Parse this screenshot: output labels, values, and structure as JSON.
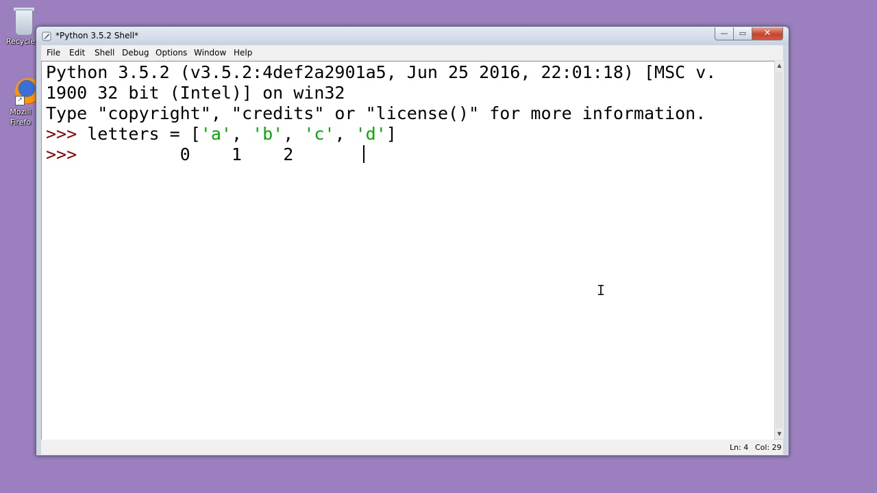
{
  "desktop": {
    "icons": [
      {
        "label": "Recycle",
        "icon": "recycle-bin-icon"
      },
      {
        "label": "Mozill\nFirefo",
        "icon": "firefox-icon"
      }
    ]
  },
  "window": {
    "title": "*Python 3.5.2 Shell*",
    "controls": {
      "minimize": "—",
      "maximize": "▭",
      "close": "✕"
    }
  },
  "menu": {
    "items": [
      "File",
      "Edit",
      "Shell",
      "Debug",
      "Options",
      "Window",
      "Help"
    ]
  },
  "shell": {
    "line1": "Python 3.5.2 (v3.5.2:4def2a2901a5, Jun 25 2016, 22:01:18) [MSC v.",
    "line2": "1900 32 bit (Intel)] on win32",
    "line3": "Type \"copyright\", \"credits\" or \"license()\" for more information.",
    "line4": {
      "prompt": ">>> ",
      "code_before": "letters = [",
      "s1": "'a'",
      "sep1": ", ",
      "s2": "'b'",
      "sep2": ", ",
      "s3": "'c'",
      "sep3": ", ",
      "s4": "'d'",
      "code_after": "]"
    },
    "line5": {
      "prompt": ">>> ",
      "content": "         0    1    2  "
    }
  },
  "statusbar": {
    "ln": "Ln: 4",
    "col": "Col: 29"
  },
  "colors": {
    "prompt": "#8b0000",
    "string": "#00aa00",
    "desktop": "#9b7fbe"
  }
}
